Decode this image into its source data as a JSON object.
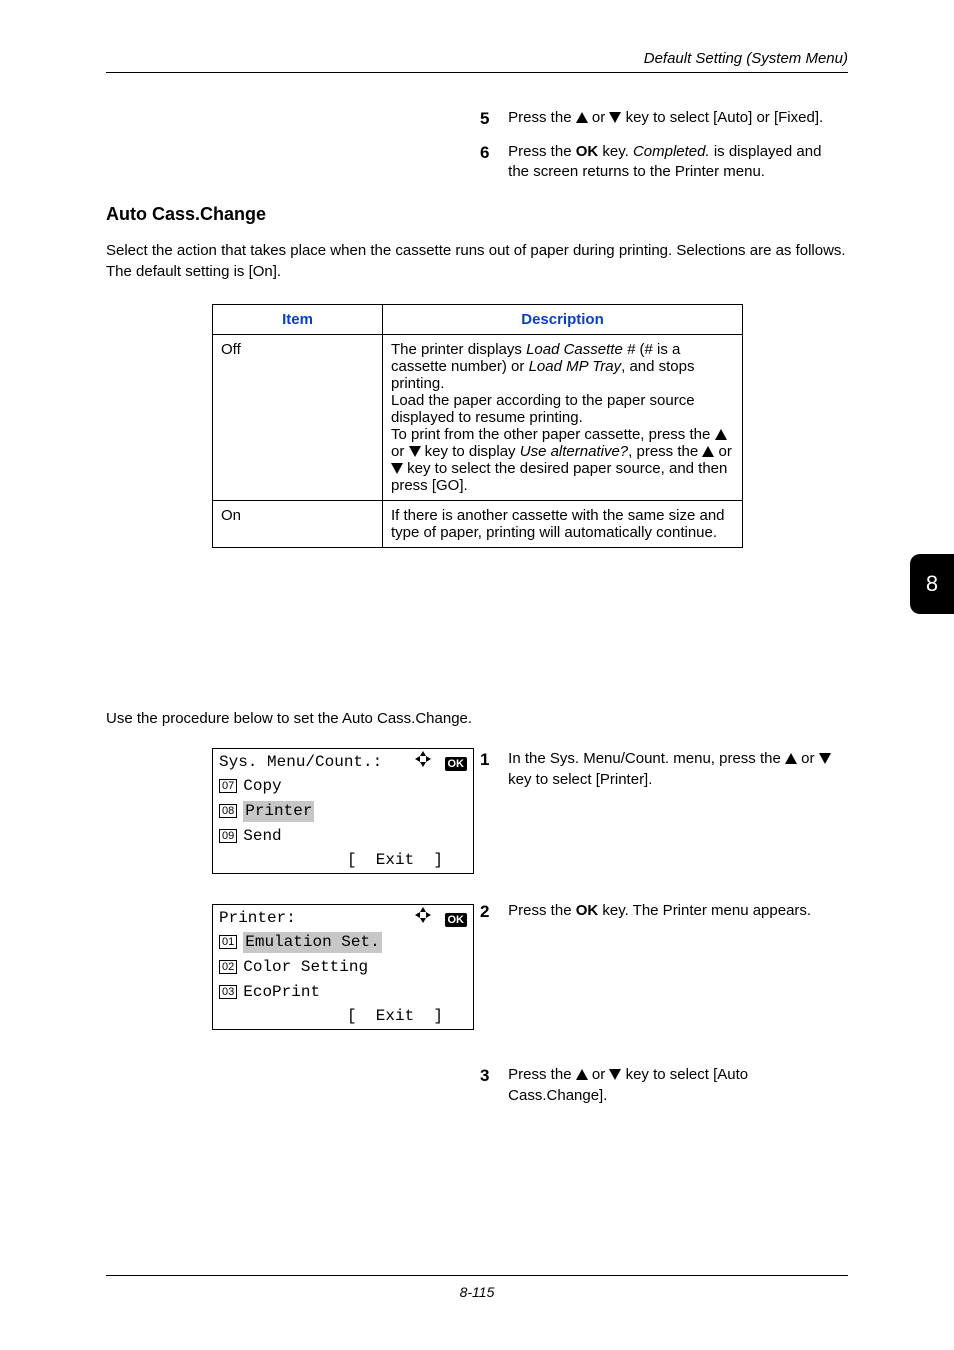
{
  "running_head": "Default Setting (System Menu)",
  "steps_top": {
    "s5": {
      "num": "5",
      "pre": "Press the ",
      "mid": " or ",
      "post": " key to select [Auto] or [Fixed]."
    },
    "s6": {
      "num": "6",
      "a": "Press the ",
      "b": "OK",
      "c": " key. ",
      "d": "Completed.",
      "e": " is displayed and the screen returns to the Printer menu."
    }
  },
  "section": {
    "title": "Auto Cass.Change",
    "intro": "Select the action that takes place when the cassette runs out of paper during printing. Selections are as follows. The default setting is [On]."
  },
  "table": {
    "h1": "Item",
    "h2": "Description",
    "rows": [
      {
        "item": "Off",
        "desc": {
          "p1a": "The printer displays ",
          "p1i": "Load Cassette #",
          "p1b": " (# is a cassette number) or ",
          "p1i2": "Load MP Tray",
          "p1c": ", and stops printing.",
          "p2": "Load the paper according to the paper source displayed to resume printing.",
          "p3a": "To print from the other paper cassette, press the ",
          "p3b": " or ",
          "p3c": " key to display ",
          "p3i": "Use alternative?",
          "p3d": ", press the ",
          "p3e": " or ",
          "p3f": " key to select the desired paper source, and then press [GO]."
        }
      },
      {
        "item": "On",
        "desc_plain": "If there is another cassette with the same size and type of paper, printing will automatically continue."
      }
    ]
  },
  "proc_intro": "Use the procedure below to set the Auto Cass.Change.",
  "lcd1": {
    "title": "Sys. Menu/Count.:",
    "items": [
      {
        "num": "07",
        "label": "Copy",
        "hl": false
      },
      {
        "num": "08",
        "label": "Printer",
        "hl": true
      },
      {
        "num": "09",
        "label": "Send",
        "hl": false
      }
    ],
    "footer": "[  Exit  ]"
  },
  "lcd2": {
    "title": "Printer:",
    "items": [
      {
        "num": "01",
        "label": "Emulation Set.",
        "hl": true
      },
      {
        "num": "02",
        "label": "Color Setting",
        "hl": false
      },
      {
        "num": "03",
        "label": "EcoPrint",
        "hl": false
      }
    ],
    "footer": "[  Exit  ]"
  },
  "steps_right": {
    "s1": {
      "num": "1",
      "a": "In the Sys. Menu/Count. menu, press the ",
      "b": " or ",
      "c": " key to select [Printer]."
    },
    "s2": {
      "num": "2",
      "a": "Press the ",
      "b": "OK",
      "c": " key. The Printer menu appears."
    },
    "s3": {
      "num": "3",
      "a": "Press the ",
      "b": " or ",
      "c": " key to select [Auto Cass.Change]."
    }
  },
  "side_tab": "8",
  "footer": "8-115"
}
